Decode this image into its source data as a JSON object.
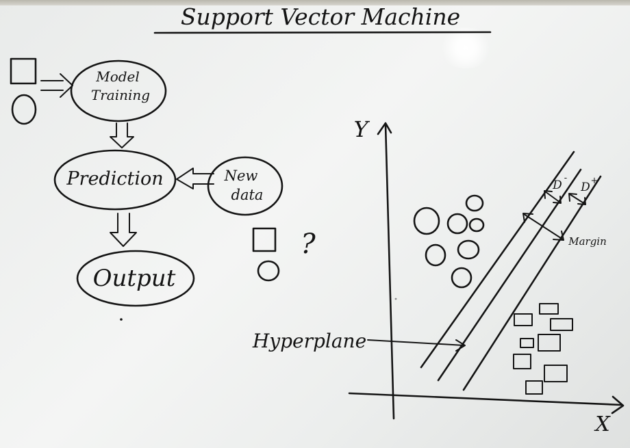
{
  "title": "Support Vector Machine",
  "flow": {
    "model_training_line1": "Model",
    "model_training_line2": "Training",
    "prediction": "Prediction",
    "new_data_line1": "New",
    "new_data_line2": "data",
    "output": "Output",
    "question_mark": "?"
  },
  "plot": {
    "y_axis_label": "Y",
    "x_axis_label": "X",
    "hyperplane_label": "Hyperplane",
    "margin_label": "Margin",
    "d_minus_label": "D",
    "d_minus_sup": "-",
    "d_plus_label": "D",
    "d_plus_sup": "+"
  },
  "colors": {
    "ink": "#141414",
    "board": "#eff0ef",
    "frame": "#c8c6bd"
  }
}
